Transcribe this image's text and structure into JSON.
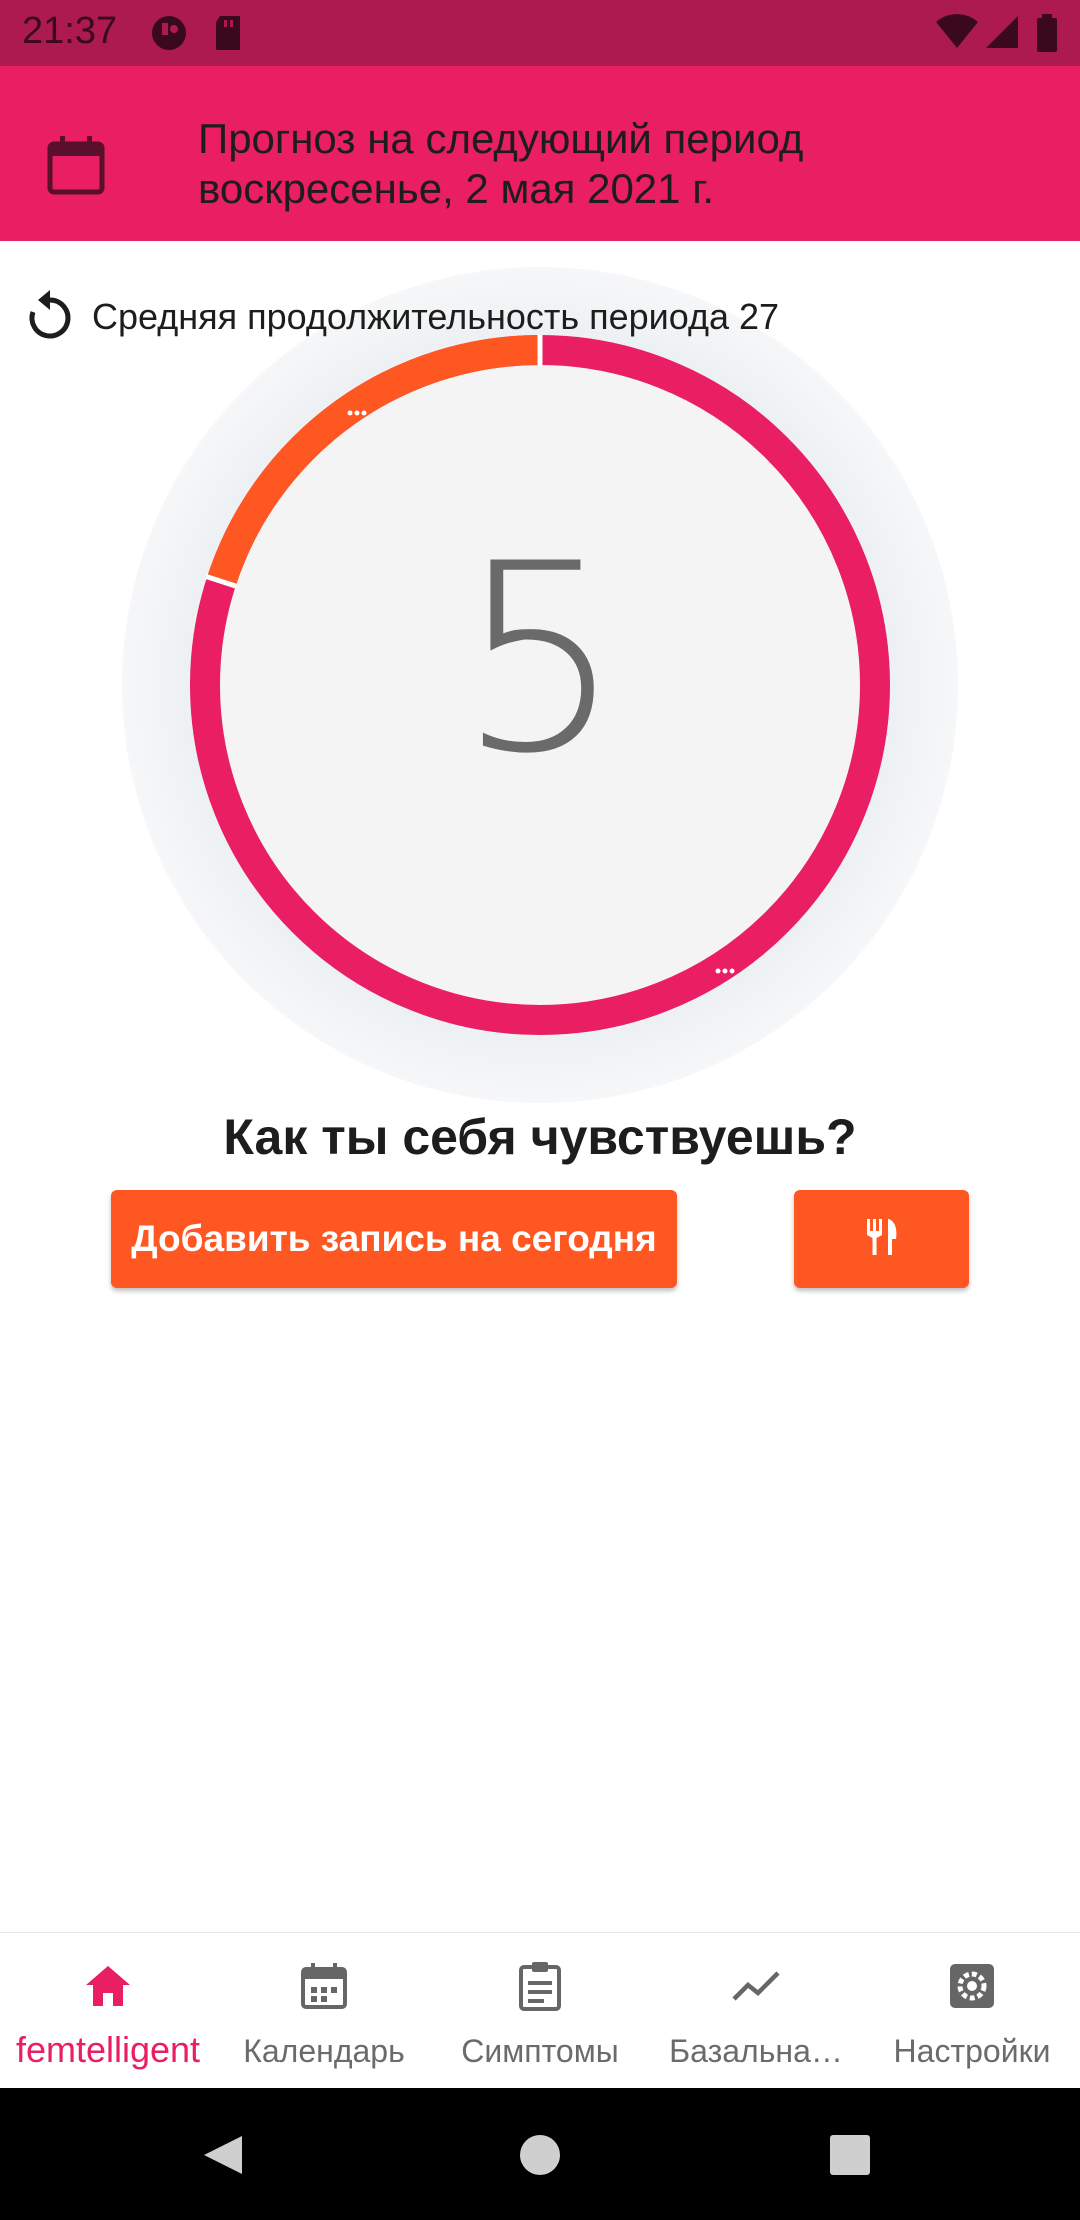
{
  "status_bar": {
    "time": "21:37"
  },
  "header": {
    "line1": "Прогноз на следующий период",
    "line2": "воскресенье, 2 мая 2021 г."
  },
  "cycle": {
    "label": "Средняя продолжительность периода 27",
    "current_day": "5",
    "period_fraction": 0.2
  },
  "question": "Как ты себя чувствуешь?",
  "buttons": {
    "add_entry": "Добавить запись на сегодня",
    "food_icon": "fork-knife-icon"
  },
  "bottom_nav": [
    {
      "label": "femtelligent",
      "icon": "home-icon",
      "active": true
    },
    {
      "label": "Календарь",
      "icon": "calendar-icon",
      "active": false
    },
    {
      "label": "Симптомы",
      "icon": "clipboard-icon",
      "active": false
    },
    {
      "label": "Базальна…",
      "icon": "trending-icon",
      "active": false
    },
    {
      "label": "Настройки",
      "icon": "gear-icon",
      "active": false
    }
  ],
  "colors": {
    "primary": "#e91e63",
    "accent": "#ff5722",
    "status_bar": "#ad1a4f"
  }
}
